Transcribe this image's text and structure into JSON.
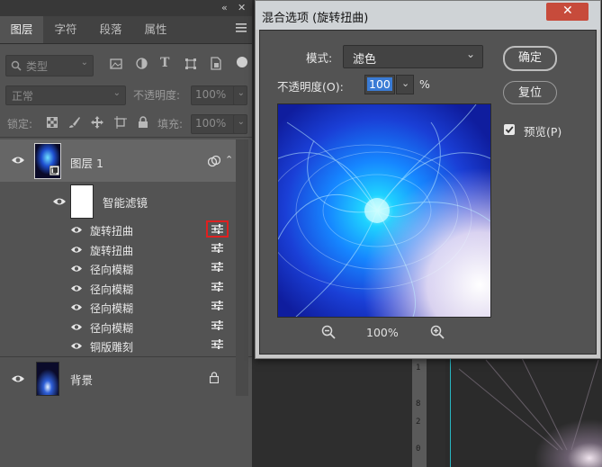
{
  "layers_panel": {
    "tabs": [
      "图层",
      "字符",
      "段落",
      "属性"
    ],
    "active_tab": 0,
    "filter_dropdown": "类型",
    "blend_mode": "正常",
    "opacity_label": "不透明度:",
    "opacity_value": "100%",
    "lock_label": "锁定:",
    "fill_label": "填充:",
    "fill_value": "100%",
    "layers": [
      {
        "name": "图层 1",
        "type": "smart-object"
      },
      {
        "name": "智能滤镜",
        "type": "smart-filter-mask"
      },
      {
        "name": "背景",
        "type": "background",
        "locked": true
      }
    ],
    "filters": [
      {
        "name": "旋转扭曲",
        "highlighted": true
      },
      {
        "name": "旋转扭曲"
      },
      {
        "name": "径向模糊"
      },
      {
        "name": "径向模糊"
      },
      {
        "name": "径向模糊"
      },
      {
        "name": "径向模糊"
      },
      {
        "name": "铜版雕刻"
      }
    ]
  },
  "dialog": {
    "title": "混合选项 (旋转扭曲)",
    "close_symbol": "✕",
    "mode_label": "模式:",
    "mode_value": "滤色",
    "opacity_label": "不透明度(O):",
    "opacity_value": "100",
    "percent": "%",
    "ok_label": "确定",
    "reset_label": "复位",
    "preview_label": "预览(P)",
    "preview_checked": true,
    "zoom": "100%"
  },
  "ruler": {
    "ticks": [
      "1",
      "8",
      "2",
      "0"
    ]
  },
  "colors": {
    "highlight": "#e02020",
    "accent_blue": "#2f7fd8",
    "guide": "#29b6c2"
  }
}
